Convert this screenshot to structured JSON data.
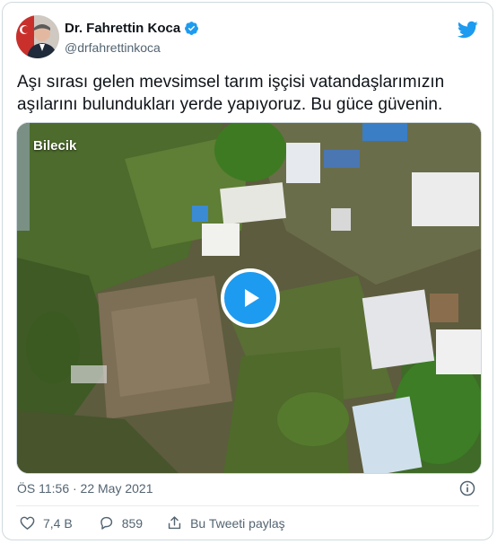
{
  "author": {
    "name": "Dr. Fahrettin Koca",
    "handle": "@drfahrettinkoca",
    "verified": true
  },
  "tweet": {
    "text": "Aşı sırası gelen mevsimsel tarım işçisi vatandaşlarımızın aşılarını bulundukları yerde yapıyoruz. Bu güce güvenin.",
    "timestamp": "ÖS 11:56 · 22 May 2021"
  },
  "media": {
    "location_label": "Bilecik",
    "play_icon": "play-icon"
  },
  "actions": {
    "likes": "7,4 B",
    "replies": "859",
    "share_label": "Bu Tweeti paylaş"
  },
  "colors": {
    "accent": "#1d9bf0",
    "text": "#0f1419",
    "secondary": "#536471",
    "border": "#cfd9de"
  }
}
